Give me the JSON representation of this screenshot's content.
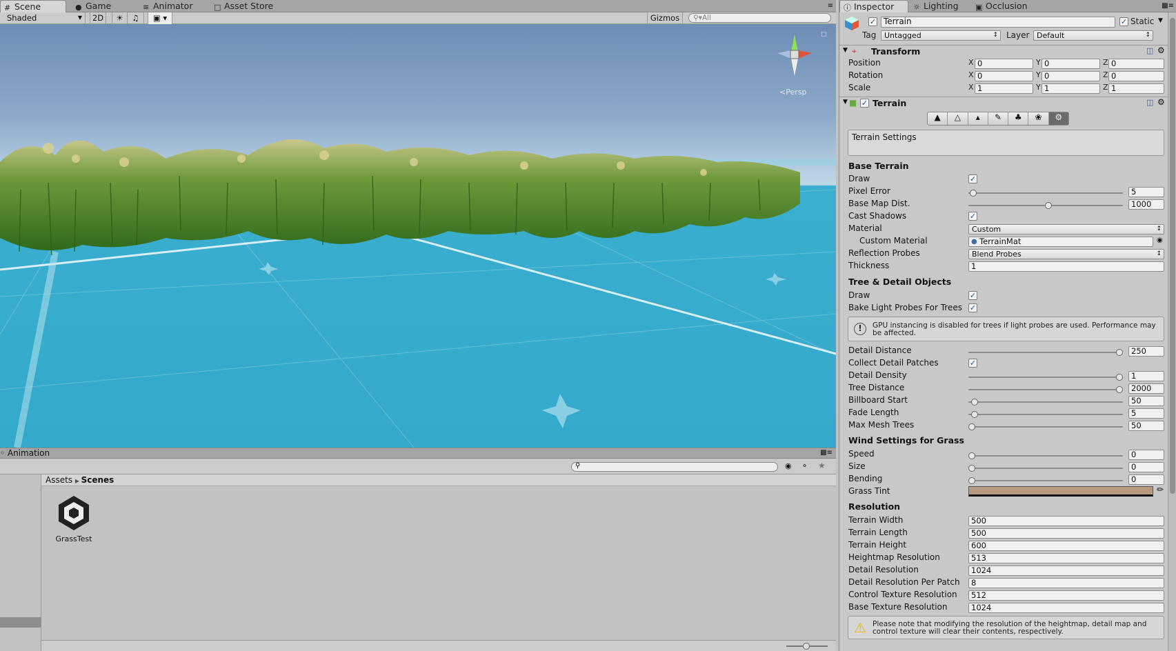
{
  "scene_tabs": [
    {
      "label": "Scene",
      "icon": "scene-icon",
      "active": true
    },
    {
      "label": "Game",
      "icon": "game-icon",
      "active": false
    },
    {
      "label": "Animator",
      "icon": "animator-icon",
      "active": false
    },
    {
      "label": "Asset Store",
      "icon": "asset-store-icon",
      "active": false
    }
  ],
  "scene_toolbar": {
    "shading": "Shaded",
    "mode_2d": "2D",
    "gizmos": "Gizmos",
    "search_placeholder": "All"
  },
  "viewport": {
    "persp_label": "Persp"
  },
  "animation_tab": "Animation",
  "project": {
    "breadcrumb_root": "Assets",
    "breadcrumb_current": "Scenes",
    "asset_name": "GrassTest"
  },
  "inspector_tabs": [
    {
      "label": "Inspector",
      "active": true
    },
    {
      "label": "Lighting",
      "active": false
    },
    {
      "label": "Occlusion",
      "active": false
    }
  ],
  "object": {
    "name": "Terrain",
    "static_label": "Static",
    "tag_label": "Tag",
    "tag": "Untagged",
    "layer_label": "Layer",
    "layer": "Default"
  },
  "transform": {
    "title": "Transform",
    "rows": [
      {
        "label": "Position",
        "x": "0",
        "y": "0",
        "z": "0"
      },
      {
        "label": "Rotation",
        "x": "0",
        "y": "0",
        "z": "0"
      },
      {
        "label": "Scale",
        "x": "1",
        "y": "1",
        "z": "1"
      }
    ],
    "axis_x": "X",
    "axis_y": "Y",
    "axis_z": "Z"
  },
  "terrain": {
    "title": "Terrain",
    "settings_box": "Terrain Settings",
    "base_terrain": "Base Terrain",
    "draw": "Draw",
    "pixel_error": "Pixel Error",
    "pixel_error_val": "5",
    "base_map_dist": "Base Map Dist.",
    "base_map_dist_val": "1000",
    "cast_shadows": "Cast Shadows",
    "material": "Material",
    "material_val": "Custom",
    "custom_material": "Custom Material",
    "custom_material_val": "TerrainMat",
    "reflection_probes": "Reflection Probes",
    "reflection_probes_val": "Blend Probes",
    "thickness": "Thickness",
    "thickness_val": "1",
    "tree_detail": "Tree & Detail Objects",
    "draw2": "Draw",
    "bake_light_probes": "Bake Light Probes For Trees",
    "gpu_warning": "GPU instancing is disabled for trees if light probes are used. Performance may be affected.",
    "detail_distance": "Detail Distance",
    "detail_distance_val": "250",
    "collect_detail_patches": "Collect Detail Patches",
    "detail_density": "Detail Density",
    "detail_density_val": "1",
    "tree_distance": "Tree Distance",
    "tree_distance_val": "2000",
    "billboard_start": "Billboard Start",
    "billboard_start_val": "50",
    "fade_length": "Fade Length",
    "fade_length_val": "5",
    "max_mesh_trees": "Max Mesh Trees",
    "max_mesh_trees_val": "50",
    "wind_settings": "Wind Settings for Grass",
    "speed": "Speed",
    "speed_val": "0",
    "size": "Size",
    "size_val": "0",
    "bending": "Bending",
    "bending_val": "0",
    "grass_tint": "Grass Tint",
    "grass_tint_color": "#b59a80",
    "resolution": "Resolution",
    "res_rows": [
      {
        "label": "Terrain Width",
        "val": "500"
      },
      {
        "label": "Terrain Length",
        "val": "500"
      },
      {
        "label": "Terrain Height",
        "val": "600"
      },
      {
        "label": "Heightmap Resolution",
        "val": "513"
      },
      {
        "label": "Detail Resolution",
        "val": "1024"
      },
      {
        "label": "Detail Resolution Per Patch",
        "val": "8"
      },
      {
        "label": "Control Texture Resolution",
        "val": "512"
      },
      {
        "label": "Base Texture Resolution",
        "val": "1024"
      }
    ],
    "res_warning": "Please note that modifying the resolution of the heightmap, detail map and control texture will clear their contents, respectively."
  }
}
